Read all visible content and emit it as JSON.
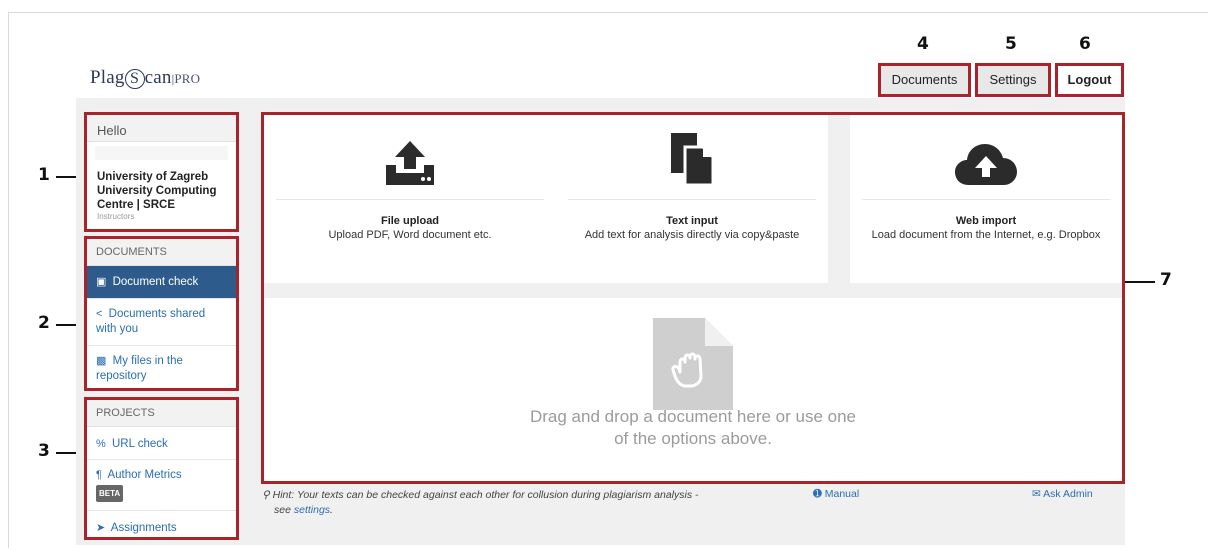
{
  "header": {
    "logo_main": "Plag",
    "logo_s": "S",
    "logo_rest": "can",
    "logo_suffix": "|PRO",
    "nav": {
      "documents": "Documents",
      "settings": "Settings",
      "logout": "Logout"
    }
  },
  "callouts": {
    "n1": "1",
    "n2": "2",
    "n3": "3",
    "n4": "4",
    "n5": "5",
    "n6": "6",
    "n7": "7"
  },
  "sidebar": {
    "hello": "Hello",
    "institution_line1": "University of Zagreb",
    "institution_line2": "University Computing",
    "institution_line3": "Centre | SRCE",
    "role": "Instructors",
    "documents": {
      "header": "DOCUMENTS",
      "items": [
        {
          "label": "Document check",
          "icon": "file-icon"
        },
        {
          "label": "Documents shared with you",
          "icon": "share-icon"
        },
        {
          "label": "My files in the repository",
          "icon": "archive-icon"
        }
      ]
    },
    "projects": {
      "header": "PROJECTS",
      "items": [
        {
          "label": "URL check",
          "icon": "link-icon"
        },
        {
          "label": "Author Metrics",
          "icon": "paragraph-icon",
          "badge": "BETA"
        },
        {
          "label": "Assignments",
          "icon": "send-icon"
        }
      ]
    }
  },
  "main": {
    "cards": [
      {
        "title": "File upload",
        "desc": "Upload PDF, Word document etc.",
        "icon": "upload-icon"
      },
      {
        "title": "Text input",
        "desc": "Add text for analysis directly via copy&paste",
        "icon": "copy-document-icon"
      },
      {
        "title": "Web import",
        "desc": "Load document from the Internet, e.g. Dropbox",
        "icon": "cloud-upload-icon"
      }
    ],
    "drop_line1": "Drag and drop a document here or use one",
    "drop_line2": "of the options above."
  },
  "footer": {
    "hint_text": "Hint: Your texts can be checked against each other for collusion during plagiarism analysis -",
    "hint_see": "see",
    "hint_link": "settings",
    "hint_end": ".",
    "manual": "Manual",
    "ask_admin": "Ask Admin"
  },
  "colors": {
    "highlight_border": "#a8232a",
    "active_nav": "#2d5c8c",
    "link": "#2a6eb5"
  }
}
